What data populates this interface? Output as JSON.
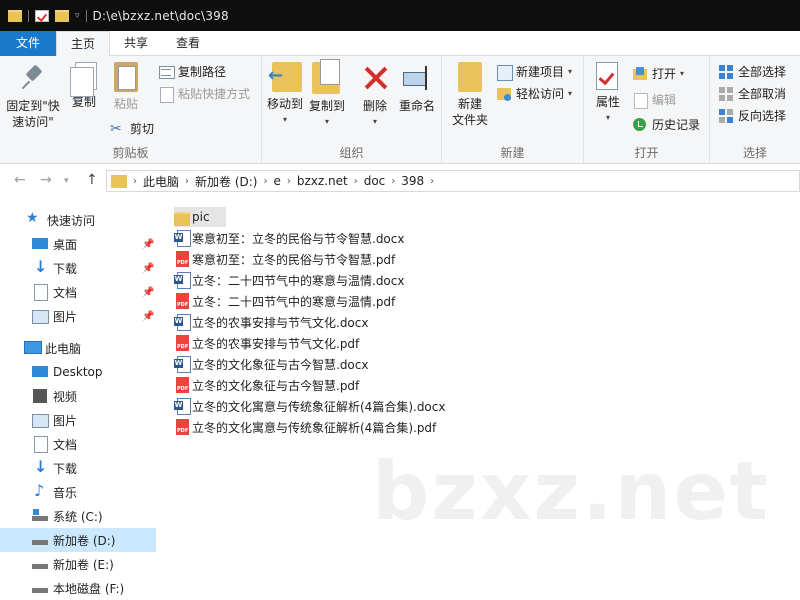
{
  "window": {
    "title_path": "D:\\e\\bzxz.net\\doc\\398"
  },
  "ribbon_tabs": [
    {
      "label": "文件"
    },
    {
      "label": "主页"
    },
    {
      "label": "共享"
    },
    {
      "label": "查看"
    }
  ],
  "clipboard": {
    "group_label": "剪贴板",
    "pin_label_1": "固定到\"快",
    "pin_label_2": "速访问\"",
    "copy_label": "复制",
    "paste_label": "粘贴",
    "copy_path_label": "复制路径",
    "paste_shortcut_label": "粘贴快捷方式",
    "cut_label": "剪切"
  },
  "organize": {
    "group_label": "组织",
    "move_to_label": "移动到",
    "copy_to_label": "复制到",
    "delete_label": "删除",
    "rename_label": "重命名"
  },
  "new_group": {
    "group_label": "新建",
    "new_folder_label_1": "新建",
    "new_folder_label_2": "文件夹",
    "new_item_label": "新建项目",
    "easy_access_label": "轻松访问"
  },
  "open_group": {
    "group_label": "打开",
    "properties_label": "属性",
    "open_label": "打开",
    "edit_label": "编辑",
    "history_label": "历史记录"
  },
  "select_group": {
    "group_label": "选择",
    "select_all_label": "全部选择",
    "select_none_label": "全部取消",
    "invert_label": "反向选择"
  },
  "address": {
    "crumbs": [
      "此电脑",
      "新加卷 (D:)",
      "e",
      "bzxz.net",
      "doc",
      "398"
    ]
  },
  "sidebar": {
    "quick_access": "快速访问",
    "quick_items": [
      "桌面",
      "下载",
      "文档",
      "图片"
    ],
    "this_pc": "此电脑",
    "pc_items": [
      "Desktop",
      "视频",
      "图片",
      "文档",
      "下载",
      "音乐",
      "系统 (C:)",
      "新加卷 (D:)",
      "新加卷 (E:)",
      "本地磁盘 (F:)"
    ]
  },
  "files": [
    {
      "name": "pic",
      "type": "folder"
    },
    {
      "name": "寒意初至：立冬的民俗与节令智慧.docx",
      "type": "docx"
    },
    {
      "name": "寒意初至：立冬的民俗与节令智慧.pdf",
      "type": "pdf"
    },
    {
      "name": "立冬：二十四节气中的寒意与温情.docx",
      "type": "docx"
    },
    {
      "name": "立冬：二十四节气中的寒意与温情.pdf",
      "type": "pdf"
    },
    {
      "name": "立冬的农事安排与节气文化.docx",
      "type": "docx"
    },
    {
      "name": "立冬的农事安排与节气文化.pdf",
      "type": "pdf"
    },
    {
      "name": "立冬的文化象征与古今智慧.docx",
      "type": "docx"
    },
    {
      "name": "立冬的文化象征与古今智慧.pdf",
      "type": "pdf"
    },
    {
      "name": "立冬的文化寓意与传统象征解析(4篇合集).docx",
      "type": "docx"
    },
    {
      "name": "立冬的文化寓意与传统象征解析(4篇合集).pdf",
      "type": "pdf"
    }
  ],
  "watermark": "bzxz.net",
  "colors": {
    "accent": "#1979ca",
    "titlebar": "#0e0e0e",
    "selection": "#cce8ff",
    "folder": "#e9c25a",
    "pdf": "#e8453c"
  }
}
